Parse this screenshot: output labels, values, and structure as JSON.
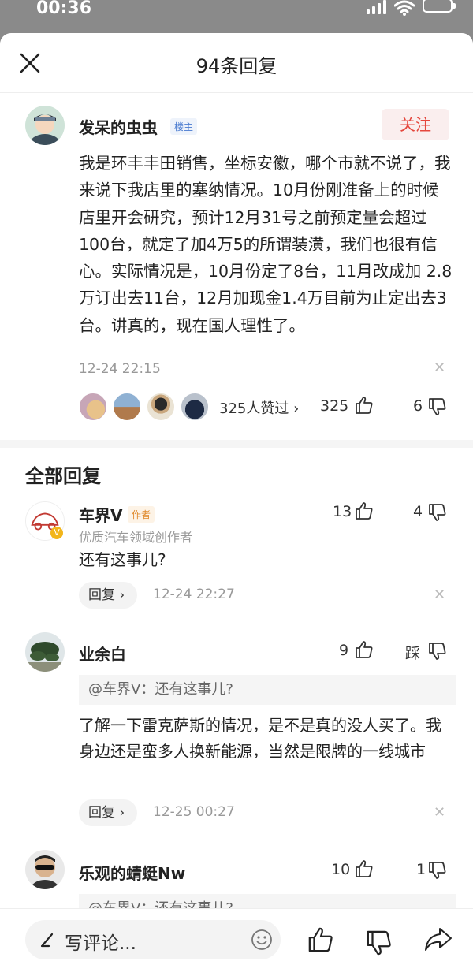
{
  "status_bar": {
    "time": "00:36"
  },
  "header": {
    "title": "94条回复"
  },
  "post": {
    "author": "发呆的虫虫",
    "owner_tag": "楼主",
    "follow_label": "关注",
    "text": "我是环丰丰田销售，坐标安徽，哪个市就不说了，我来说下我店里的塞纳情况。10月份刚准备上的时候店里开会研究，预计12月31号之前预定量会超过100台，就定了加4万5的所谓装潢，我们也很有信心。实际情况是，10月份定了8台，11月改成加 2.8万订出去11台，12月加现金1.4万目前为止定出去3台。讲真的，现在国人理性了。",
    "timestamp": "12-24 22:15",
    "likers_text": "325人赞过 ›",
    "like_count": "325",
    "dislike_count": "6"
  },
  "replies_section": {
    "title": "全部回复"
  },
  "replies": [
    {
      "author": "车界V",
      "tag": "作者",
      "subtitle": "优质汽车领域创作者",
      "text": "还有这事儿?",
      "reply_label": "回复 ›",
      "timestamp": "12-24 22:27",
      "like_count": "13",
      "dislike_count": "4"
    },
    {
      "author": "业余白",
      "quote": "@车界V：还有这事儿?",
      "text": "了解一下雷克萨斯的情况，是不是真的没人买了。我身边还是蛮多人换新能源，当然是限牌的一线城市",
      "reply_label": "回复 ›",
      "timestamp": "12-25 00:27",
      "like_count": "9",
      "dislike_label": "踩"
    },
    {
      "author": "乐观的蜻蜓Nw",
      "quote": "@车界V：还有这事儿?",
      "like_count": "10",
      "dislike_count": "1"
    }
  ],
  "bottom_bar": {
    "comment_placeholder": "写评论..."
  },
  "colors": {
    "accent": "#e5473d",
    "owner_tag": "#4a7bd0",
    "author_tag": "#e08a2c"
  }
}
